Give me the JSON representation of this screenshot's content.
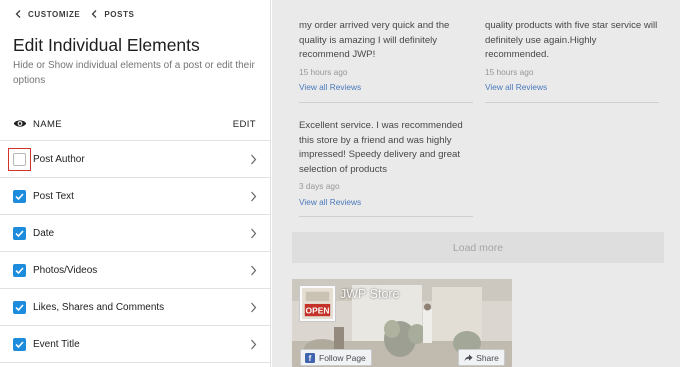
{
  "breadcrumbs": [
    "CUSTOMIZE",
    "POSTS"
  ],
  "panel": {
    "title": "Edit Individual Elements",
    "subtitle": "Hide or Show individual elements of a post or edit their options",
    "col_name": "NAME",
    "col_edit": "EDIT"
  },
  "elements": [
    {
      "label": "Post Author",
      "checked": false,
      "highlighted": true
    },
    {
      "label": "Post Text",
      "checked": true
    },
    {
      "label": "Date",
      "checked": true
    },
    {
      "label": "Photos/Videos",
      "checked": true
    },
    {
      "label": "Likes, Shares and Comments",
      "checked": true
    },
    {
      "label": "Event Title",
      "checked": true
    }
  ],
  "reviews": [
    {
      "text": "my order arrived very quick and the quality is amazing I will definitely recommend JWP!",
      "time": "15 hours ago",
      "link": "View all Reviews"
    },
    {
      "text": "quality products with five star service will definitely use again.Highly recommended.",
      "time": "15 hours ago",
      "link": "View all Reviews"
    },
    {
      "text": "Excellent service. I was recommended this store by a friend and was highly impressed! Speedy delivery and great selection of products",
      "time": "3 days ago",
      "link": "View all Reviews"
    }
  ],
  "load_more": "Load more",
  "facebook": {
    "page_name": "JWP Store",
    "follow_label": "Follow Page",
    "share_label": "Share",
    "logo_text": "OPEN"
  },
  "colors": {
    "checkbox": "#1e8cdd",
    "highlight": "#d0342c",
    "link": "#4c7cc0",
    "facebook": "#4267b2"
  }
}
